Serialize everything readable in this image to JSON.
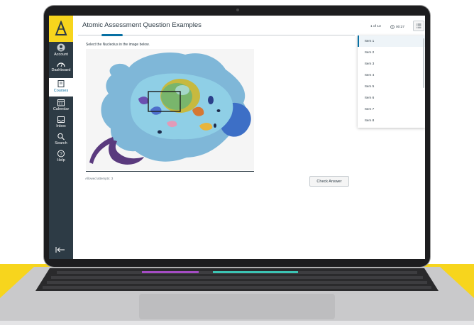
{
  "page": {
    "title": "Atomic Assessment Question Examples"
  },
  "nav": {
    "items": [
      {
        "label": "Account",
        "icon": "account-icon"
      },
      {
        "label": "Dashboard",
        "icon": "dashboard-icon"
      },
      {
        "label": "Courses",
        "icon": "courses-icon"
      },
      {
        "label": "Calendar",
        "icon": "calendar-icon"
      },
      {
        "label": "Inbox",
        "icon": "inbox-icon"
      },
      {
        "label": "Search",
        "icon": "search-icon"
      },
      {
        "label": "Help",
        "icon": "help-icon"
      }
    ],
    "active": "Courses"
  },
  "question": {
    "prompt": "Select the Nucleolus in the image below.",
    "attempts": "Allowed attempts: 3",
    "check_label": "Check Answer"
  },
  "toolbar": {
    "counter": "1 of 13",
    "timer": "00:27"
  },
  "items": [
    "Item 1",
    "Item 2",
    "Item 3",
    "Item 4",
    "Item 5",
    "Item 6",
    "Item 7",
    "Item 8"
  ],
  "colors": {
    "nav_bg": "#2d3b45",
    "brand_yellow": "#f7d51d",
    "accent_blue": "#0770a3"
  }
}
